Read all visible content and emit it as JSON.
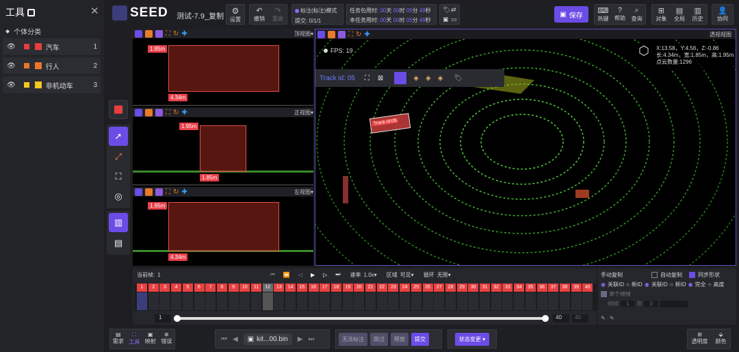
{
  "left_panel": {
    "title": "工具",
    "section": "个体分类",
    "classes": [
      {
        "label": "汽车",
        "index": "1",
        "color": "#e83e3e"
      },
      {
        "label": "行人",
        "index": "2",
        "color": "#e8772a"
      },
      {
        "label": "非机动车",
        "index": "3",
        "color": "#f2c81f"
      }
    ]
  },
  "header": {
    "logo": "SEED",
    "task_name": "测试-7.9_复制",
    "settings": "设置",
    "undo": "撤销",
    "redo": "重做",
    "mode": "标注(标注)模式",
    "submit_count": "提交: 0/1/1",
    "task_total_label": "任务包用时:",
    "task_current_label": "本任务用时:",
    "time_total": [
      "00",
      "天",
      "00",
      "时",
      "05",
      "分",
      "49",
      "秒"
    ],
    "time_current": [
      "00",
      "天",
      "00",
      "时",
      "05",
      "分",
      "49",
      "秒"
    ],
    "save": "保存",
    "right_buttons": [
      "热键",
      "帮助",
      "查询",
      "对象",
      "全局",
      "历史",
      "协同"
    ]
  },
  "views": {
    "top_label": "顶视图",
    "front_label": "正视图",
    "left_label": "左视图",
    "persp_label": "透视视图",
    "top_dims": [
      "1.85m",
      "4.34m"
    ],
    "front_dims": [
      "1.95m",
      "1.85m"
    ],
    "left_dims": [
      "1.95m",
      "4.34m"
    ]
  },
  "main_view": {
    "fps": "FPS: 19",
    "coords": "X:13.58，Y:4.56，Z:-0.86",
    "size": "长:4.34m，宽:1.85m，高:1.95m",
    "points": "点云数量:1296",
    "obj_class": "汽车",
    "track_id": "Track id: 05",
    "tag_label": "Track id:05"
  },
  "timeline": {
    "current_frame_label": "当前帧:",
    "current_frame": "1",
    "speed_label": "速率",
    "speed": "1.0x",
    "area_label": "区域",
    "area_value": "可见",
    "loop_label": "循环",
    "loop_value": "无限",
    "frames": [
      "1",
      "2",
      "3",
      "4",
      "5",
      "6",
      "7",
      "8",
      "9",
      "10",
      "11",
      "12",
      "13",
      "14",
      "15",
      "16",
      "17",
      "18",
      "19",
      "20",
      "21",
      "22",
      "23",
      "24",
      "25",
      "26",
      "27",
      "28",
      "29",
      "30",
      "31",
      "32",
      "33",
      "34",
      "35",
      "36",
      "37",
      "38",
      "39",
      "40"
    ],
    "range_start": "1",
    "range_end": "40",
    "range_end2": "40"
  },
  "right_settings": {
    "manual_copy": "手动复制",
    "auto_copy": "自动复制",
    "sync_shape": "同步形状",
    "opts1": [
      "关联ID",
      "新ID"
    ],
    "opts2": [
      "关联ID",
      "新ID"
    ],
    "opts3": [
      "完全",
      "高度"
    ],
    "sub_label": "单个帧帧",
    "frame_word": "帧帧",
    "to_label": "到",
    "frame_a": "1",
    "frame_b": "0"
  },
  "bottom": {
    "tools": [
      "需求",
      "工具",
      "映射",
      "错误"
    ],
    "filename": "kit...00.bin",
    "btns": [
      "无法标注",
      "跳过",
      "释放",
      "提交"
    ],
    "state_change": "状态变更",
    "right_tools": [
      "透明度",
      "颜色"
    ]
  }
}
